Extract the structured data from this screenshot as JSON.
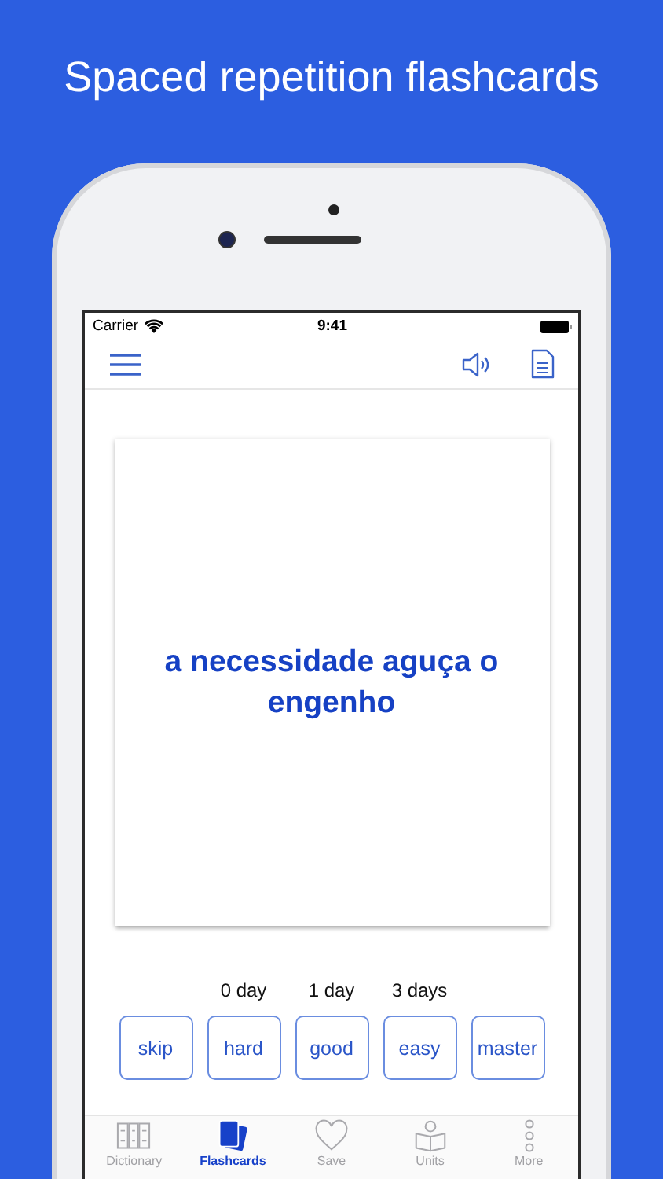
{
  "headline": "Spaced repetition flashcards",
  "status_bar": {
    "carrier": "Carrier",
    "time": "9:41"
  },
  "card": {
    "text": "a necessidade aguça o engenho"
  },
  "answers": [
    {
      "label": "skip"
    },
    {
      "label": "hard",
      "interval": "0 day"
    },
    {
      "label": "good",
      "interval": "1 day"
    },
    {
      "label": "easy",
      "interval": "3 days"
    },
    {
      "label": "master"
    }
  ],
  "tabs": [
    {
      "label": "Dictionary",
      "kind": "books",
      "selected": false
    },
    {
      "label": "Flashcards",
      "kind": "cards",
      "selected": true
    },
    {
      "label": "Save",
      "kind": "heart",
      "selected": false
    },
    {
      "label": "Units",
      "kind": "reader",
      "selected": false
    },
    {
      "label": "More",
      "kind": "dots",
      "selected": false
    }
  ]
}
